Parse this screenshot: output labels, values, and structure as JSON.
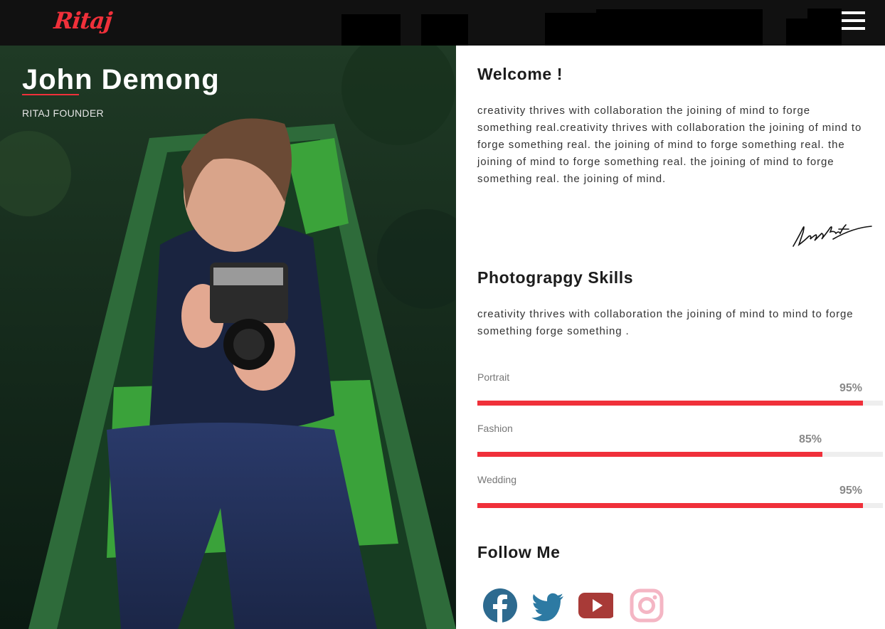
{
  "brand": {
    "logo_text": "Ritaj",
    "accent": "#f0303a"
  },
  "hero": {
    "name": "John Demong",
    "role": "RITAJ FOUNDER"
  },
  "welcome": {
    "heading": "Welcome !",
    "lines": [
      "creativity thrives with collaboration the joining of mind to forge",
      "something real.creativity thrives with collaboration the joining of mind to",
      "forge something real. the joining of mind to forge something real. the",
      "joining of mind to forge something real. the joining of mind to forge",
      "something real. the joining of mind."
    ]
  },
  "skills": {
    "heading": "Photograpgy Skills",
    "lines": [
      "creativity thrives with collaboration the joining of mind to mind to forge",
      "something forge something ."
    ],
    "items": [
      {
        "label": "Portrait",
        "percent_text": "95%",
        "value": 95
      },
      {
        "label": "Fashion",
        "percent_text": "85%",
        "value": 85
      },
      {
        "label": "Wedding",
        "percent_text": "95%",
        "value": 95
      }
    ]
  },
  "follow": {
    "heading": "Follow Me",
    "icons": [
      "facebook-icon",
      "twitter-icon",
      "youtube-icon",
      "instagram-icon"
    ],
    "colors": {
      "facebook": "#2d6a8f",
      "twitter": "#2d7aa3",
      "youtube": "#a83a37",
      "instagram": "#f4b6c4"
    }
  }
}
